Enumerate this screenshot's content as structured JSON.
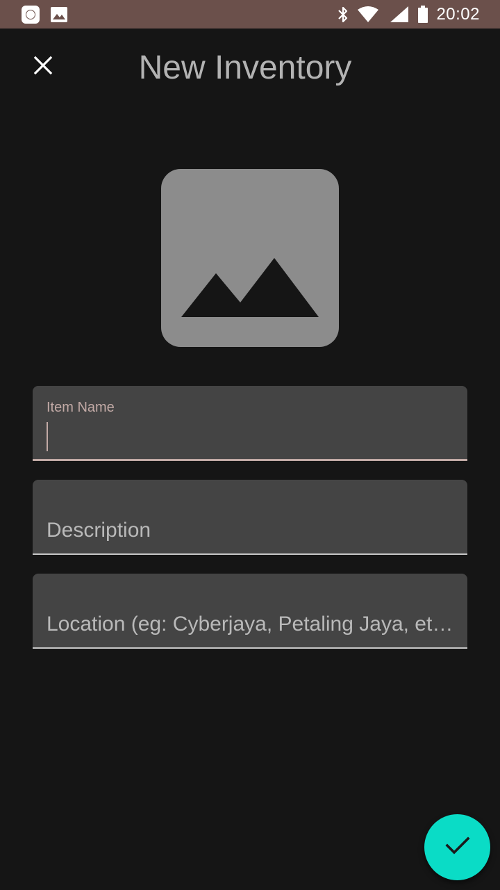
{
  "status_bar": {
    "time": "20:02",
    "left_icons": [
      "app-notification-icon",
      "image-notification-icon"
    ],
    "right_icons": [
      "bluetooth-icon",
      "wifi-icon",
      "cell-signal-icon",
      "battery-icon"
    ]
  },
  "app_bar": {
    "title": "New Inventory",
    "close_icon": "close-icon"
  },
  "image_picker": {
    "icon": "image-placeholder-icon"
  },
  "form": {
    "item_name": {
      "label": "Item Name",
      "value": ""
    },
    "description": {
      "placeholder": "Description",
      "value": ""
    },
    "location": {
      "placeholder": "Location (eg: Cyberjaya, Petaling Jaya, et…",
      "value": ""
    }
  },
  "fab": {
    "icon": "check-icon"
  },
  "colors": {
    "status_bar": "#6b504b",
    "background": "#151515",
    "field_background": "#444444",
    "accent_label": "#c2aaa6",
    "fab": "#0adcc6"
  }
}
